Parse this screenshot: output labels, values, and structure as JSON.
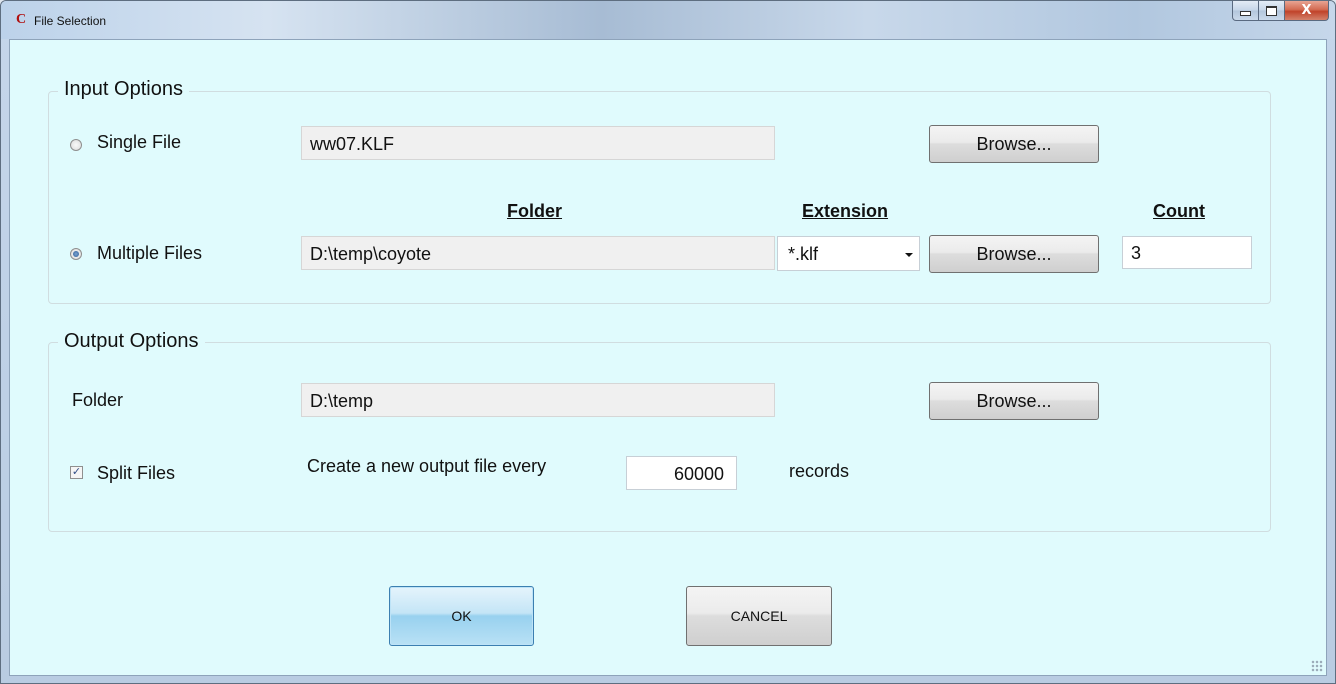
{
  "window": {
    "title": "File Selection",
    "icon_letter": "C",
    "close_glyph": "X"
  },
  "input_options": {
    "group_title": "Input Options",
    "single_file": {
      "label": "Single File",
      "checked": false,
      "value": "ww07.KLF",
      "browse_label": "Browse..."
    },
    "headers": {
      "folder": "Folder",
      "extension": "Extension",
      "count": "Count"
    },
    "multiple_files": {
      "label": "Multiple Files",
      "checked": true,
      "folder_value": "D:\\temp\\coyote",
      "extension_value": "*.klf",
      "browse_label": "Browse...",
      "count_value": "3"
    }
  },
  "output_options": {
    "group_title": "Output Options",
    "folder_label": "Folder",
    "folder_value": "D:\\temp",
    "browse_label": "Browse...",
    "split_files_label": "Split Files",
    "split_files_checked": true,
    "split_prefix": "Create a new output file every",
    "split_value": "60000",
    "split_suffix": "records"
  },
  "buttons": {
    "ok": "OK",
    "cancel": "CANCEL"
  },
  "icons": {
    "app": "app-c-icon",
    "minimize": "minimize-icon",
    "maximize": "maximize-icon",
    "close": "close-icon",
    "check": "✓",
    "dropdown": "chevron-down-icon",
    "resize_grip": "resize-grip-icon"
  }
}
